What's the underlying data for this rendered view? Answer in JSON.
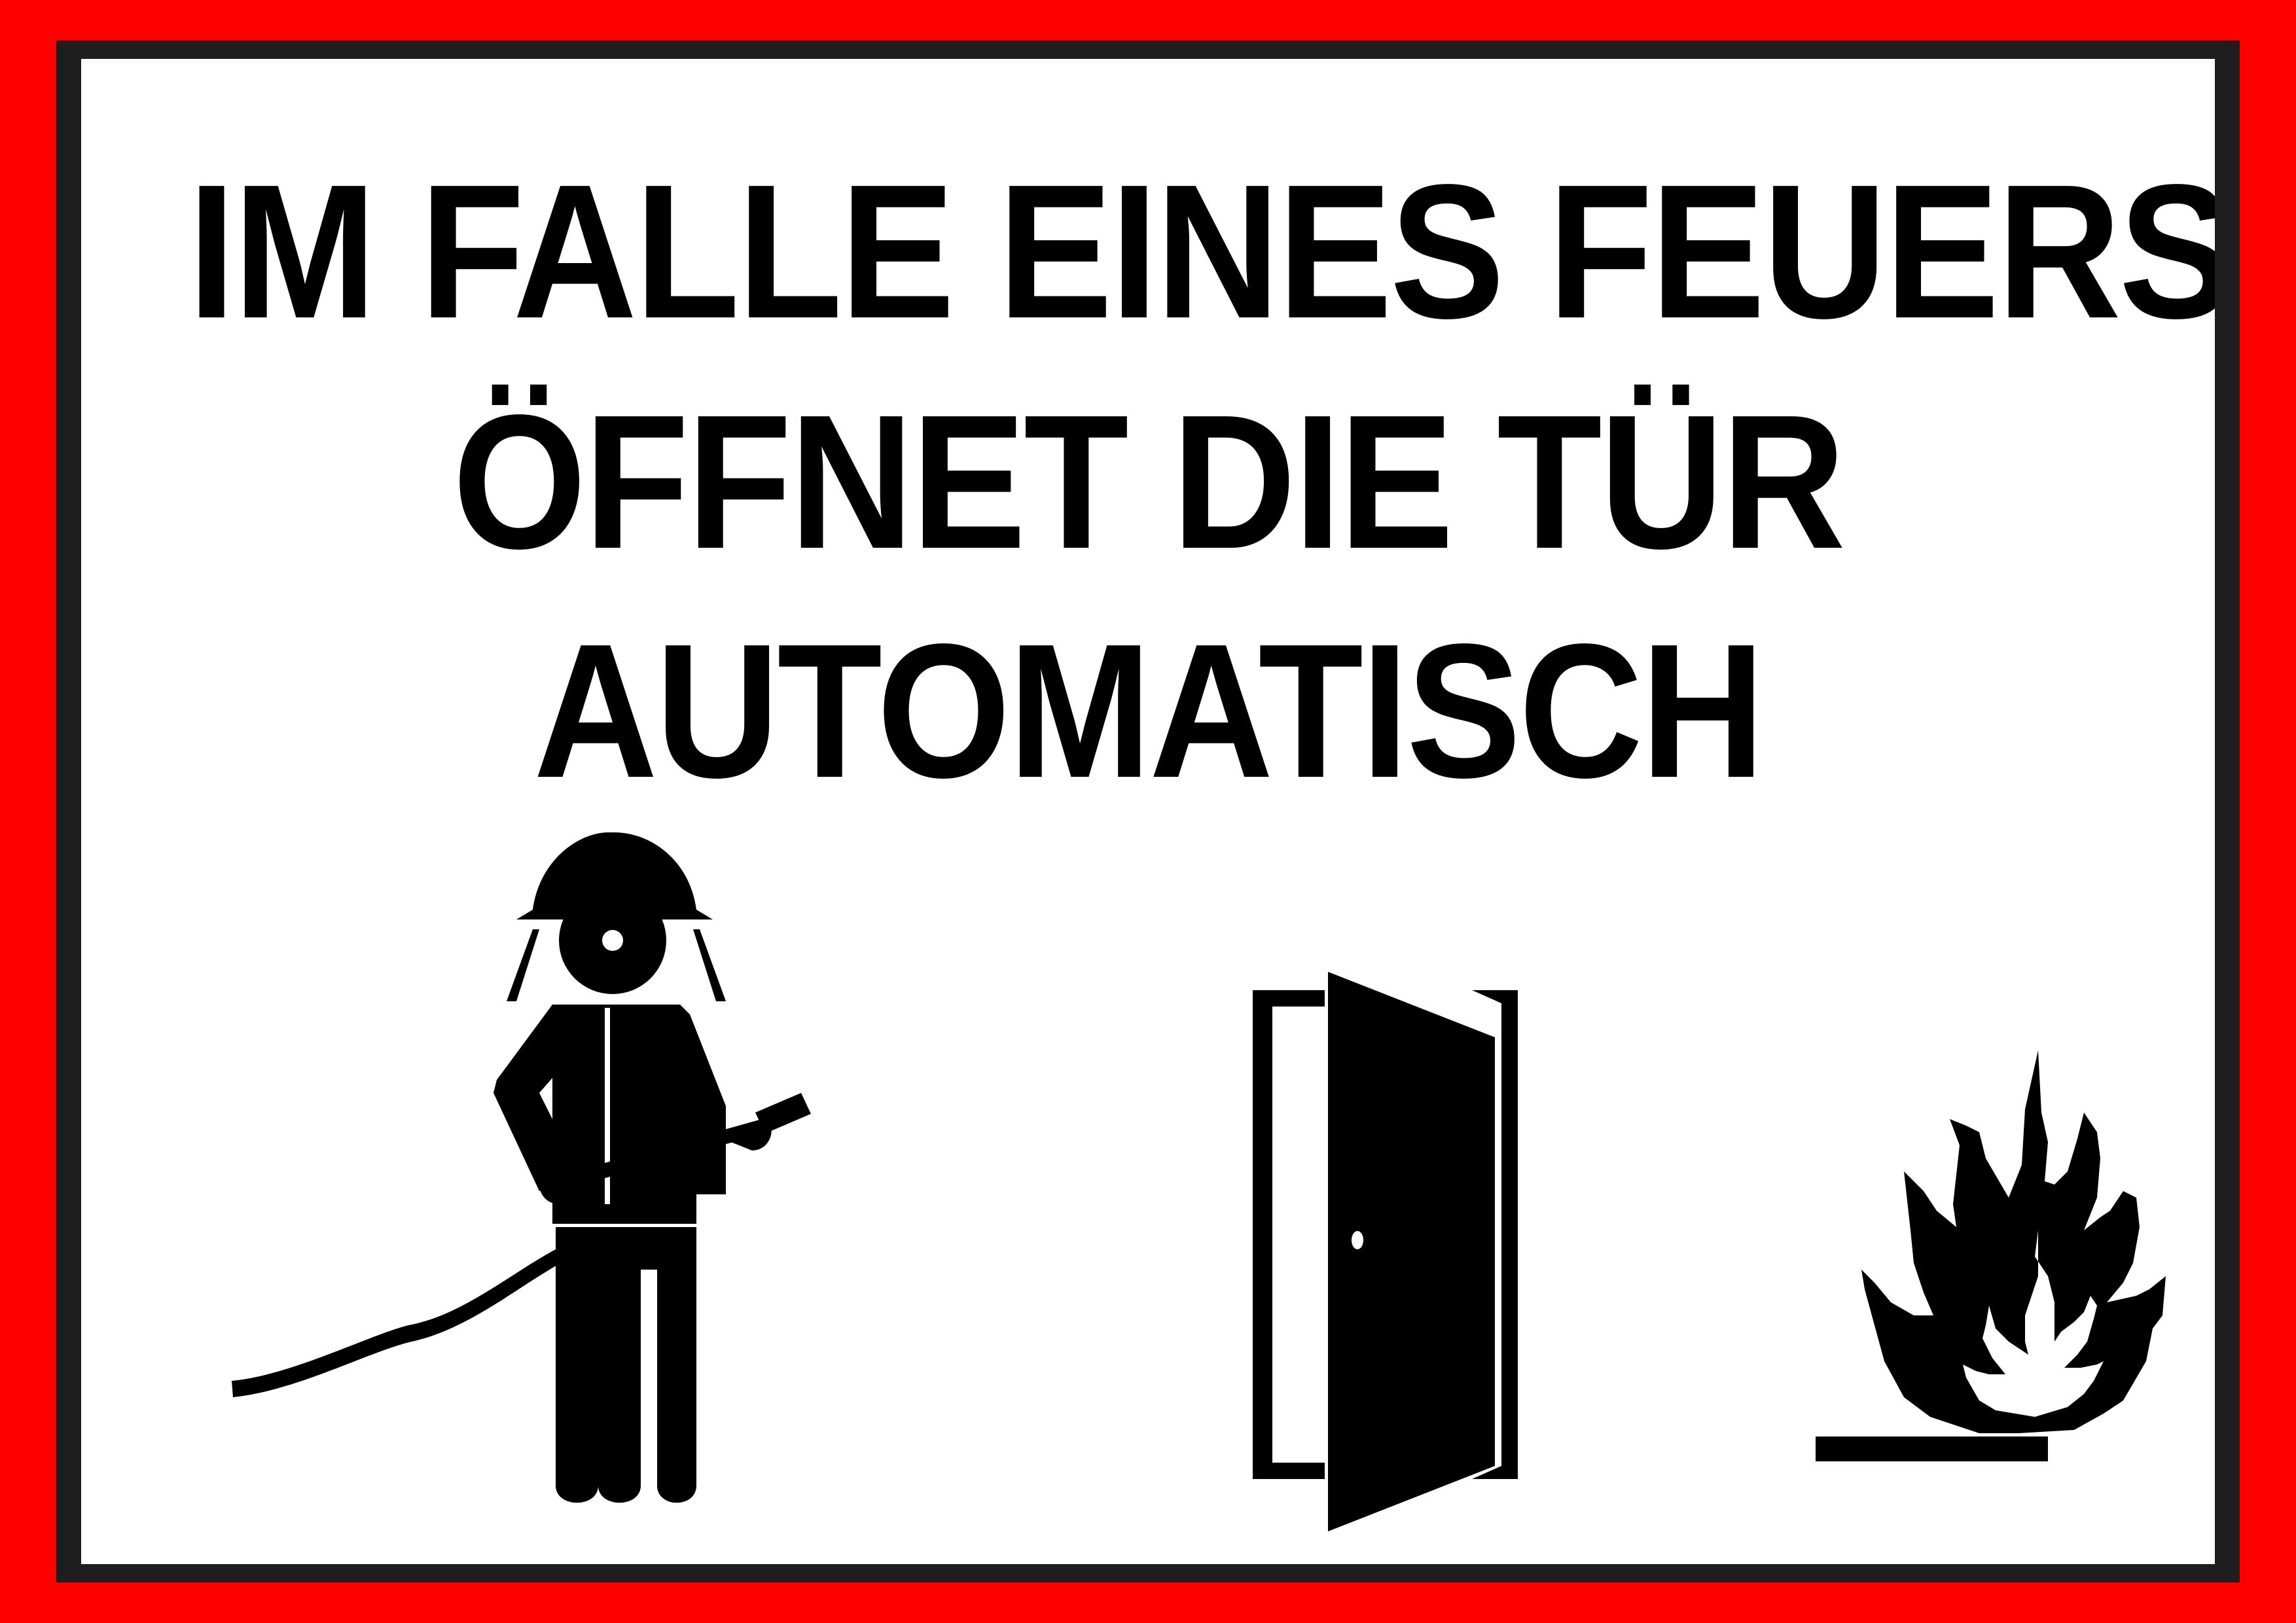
{
  "sign": {
    "line1": "IM FALLE EINES FEUERS",
    "line2": "ÖFFNET DIE TÜR",
    "line3": "AUTOMATISCH",
    "colors": {
      "outer_frame": "#ff0000",
      "inner_border": "#1e1e1e",
      "background": "#ffffff",
      "ink": "#000000"
    },
    "pictograms": [
      "firefighter-with-hose-icon",
      "open-door-icon",
      "flame-icon"
    ]
  }
}
